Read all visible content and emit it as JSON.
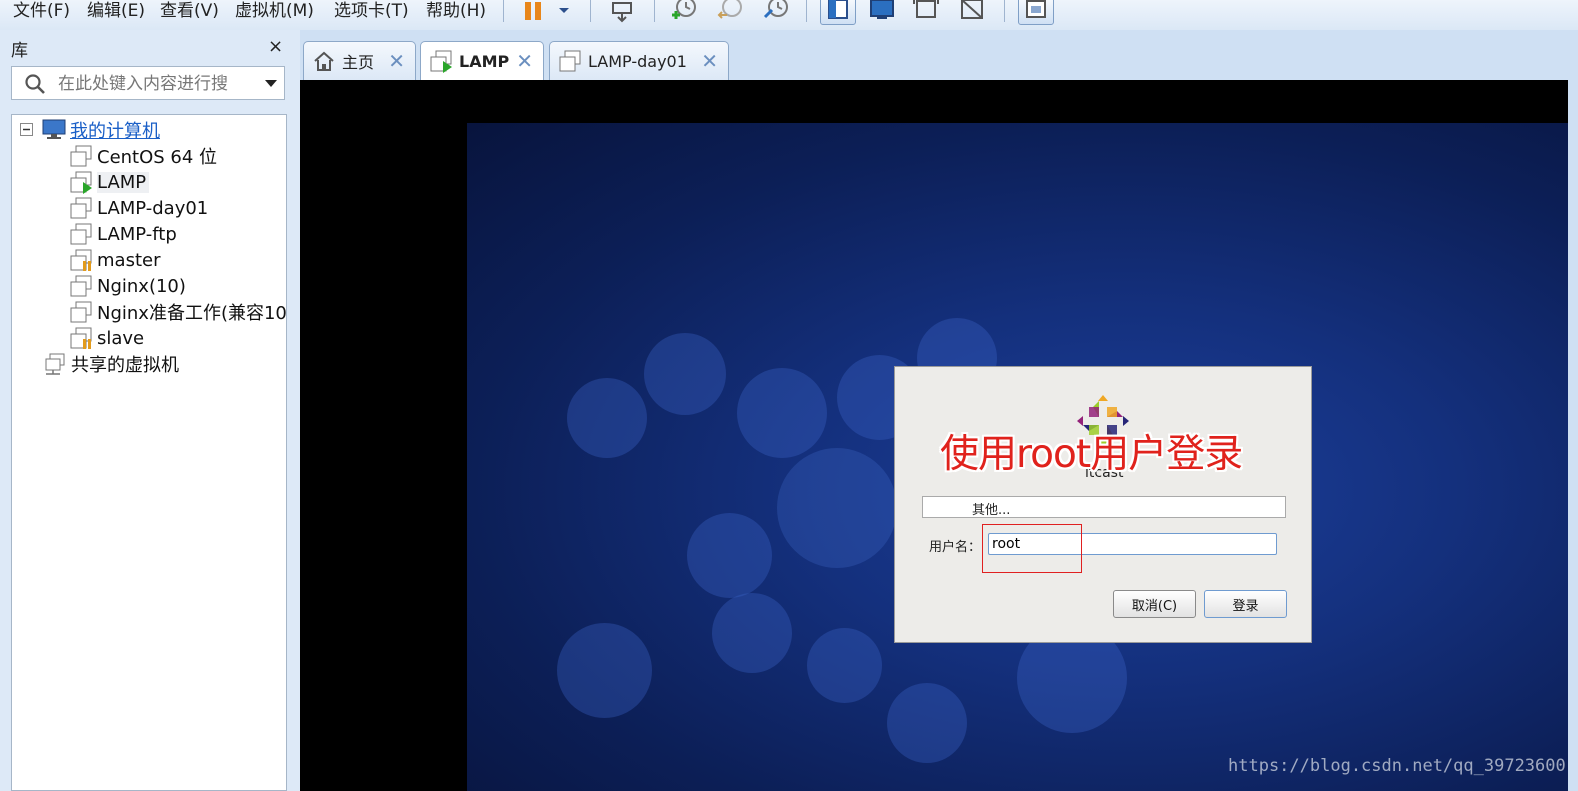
{
  "menubar": {
    "items": [
      "文件(F)",
      "编辑(E)",
      "查看(V)",
      "虚拟机(M)",
      "选项卡(T)",
      "帮助(H)"
    ]
  },
  "toolbar": {
    "icons": [
      "suspend-icon",
      "dropdown-icon",
      "send-ctrl-alt-del-icon",
      "snapshot-take-icon",
      "snapshot-revert-icon",
      "snapshot-manager-icon",
      "library-view-icon",
      "console-view-icon",
      "fullscreen-icon",
      "unity-icon",
      "thumbnail-view-icon"
    ]
  },
  "library": {
    "title": "库",
    "close": "×",
    "search_placeholder": "在此处键入内容进行搜",
    "tree": {
      "root": "我的计算机",
      "items": [
        {
          "label": "CentOS 64 位",
          "state": "off"
        },
        {
          "label": "LAMP",
          "state": "running"
        },
        {
          "label": "LAMP-day01",
          "state": "off"
        },
        {
          "label": "LAMP-ftp",
          "state": "off"
        },
        {
          "label": "master",
          "state": "suspended"
        },
        {
          "label": "Nginx(10)",
          "state": "off"
        },
        {
          "label": "Nginx准备工作(兼容10",
          "state": "off"
        },
        {
          "label": "slave",
          "state": "suspended"
        }
      ],
      "shared": "共享的虚拟机"
    }
  },
  "tabs": [
    {
      "label": "主页",
      "close": "✕",
      "active": false
    },
    {
      "label": "LAMP",
      "close": "✕",
      "active": true
    },
    {
      "label": "LAMP-day01",
      "close": "✕",
      "active": false
    }
  ],
  "login_dialog": {
    "annotation": "使用root用户登录",
    "hostname": "itcast",
    "other": "其他...",
    "username_label": "用户名：",
    "username_value": "root",
    "cancel": "取消(C)",
    "login": "登录"
  },
  "watermark": "https://blog.csdn.net/qq_39723600",
  "colors": {
    "annotation": "#e0221c",
    "highlight": "#e02020",
    "desktop": "#14307d",
    "vm_running": "#2aa52a",
    "vm_suspended": "#e29b1d"
  }
}
